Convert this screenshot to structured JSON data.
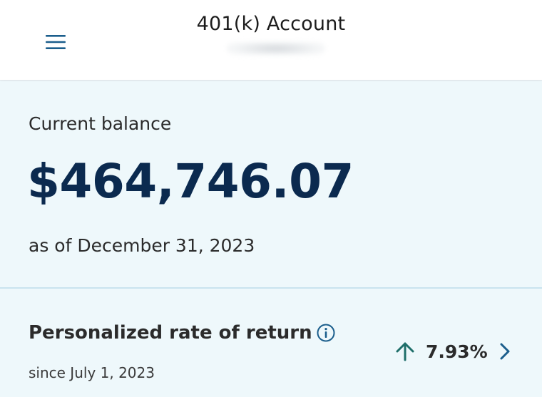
{
  "header": {
    "title": "401(k) Account",
    "menu_icon": "hamburger-menu-icon"
  },
  "balance": {
    "label": "Current balance",
    "value": "$464,746.07",
    "as_of": "as of December 31, 2023"
  },
  "rate_of_return": {
    "label": "Personalized rate of return",
    "info_icon": "info-icon",
    "since": "since July 1, 2023",
    "value": "7.93%",
    "trend_icon": "arrow-up-icon",
    "trend_color": "#1f6f6a",
    "nav_icon": "chevron-right-icon"
  },
  "colors": {
    "accent": "#1b5e8c",
    "balance_text": "#0b2a4f",
    "section_background": "#eef8fb"
  }
}
